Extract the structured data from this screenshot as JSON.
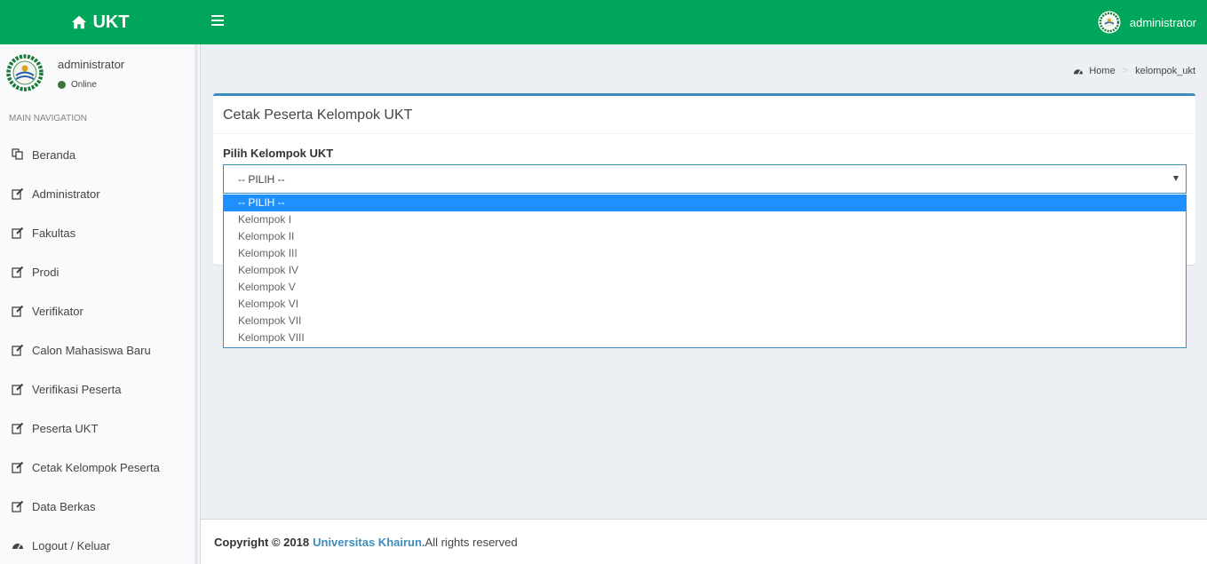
{
  "header": {
    "logo_text": "UKT",
    "user_name": "administrator"
  },
  "sidebar": {
    "user_name": "administrator",
    "status": "Online",
    "nav_header": "MAIN NAVIGATION",
    "items": [
      {
        "label": "Beranda",
        "icon": "copy-icon"
      },
      {
        "label": "Administrator",
        "icon": "edit-icon"
      },
      {
        "label": "Fakultas",
        "icon": "edit-icon"
      },
      {
        "label": "Prodi",
        "icon": "edit-icon"
      },
      {
        "label": "Verifikator",
        "icon": "edit-icon"
      },
      {
        "label": "Calon Mahasiswa Baru",
        "icon": "edit-icon"
      },
      {
        "label": "Verifikasi Peserta",
        "icon": "edit-icon"
      },
      {
        "label": "Peserta UKT",
        "icon": "edit-icon"
      },
      {
        "label": "Cetak Kelompok Peserta",
        "icon": "edit-icon"
      },
      {
        "label": "Data Berkas",
        "icon": "edit-icon"
      },
      {
        "label": "Logout / Keluar",
        "icon": "dashboard-icon"
      }
    ]
  },
  "breadcrumb": {
    "home": "Home",
    "current": "kelompok_ukt"
  },
  "box": {
    "title": "Cetak Peserta Kelompok UKT",
    "field_label": "Pilih Kelompok UKT",
    "select_value": "-- PILIH --",
    "options": [
      "-- PILIH --",
      "Kelompok I",
      "Kelompok II",
      "Kelompok III",
      "Kelompok IV",
      "Kelompok V",
      "Kelompok VI",
      "Kelompok VII",
      "Kelompok VIII"
    ]
  },
  "footer": {
    "copyright": "Copyright © 2018",
    "org": "Universitas Khairun.",
    "rights": " All rights reserved"
  },
  "colors": {
    "header": "#00a65a",
    "accent": "#3c8dbc",
    "selected_option": "#1e90ff"
  }
}
